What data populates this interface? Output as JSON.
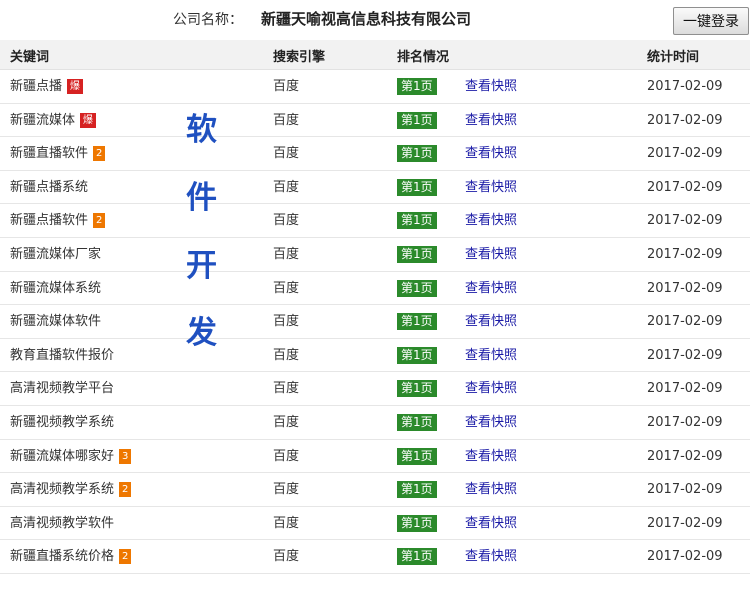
{
  "company": {
    "label": "公司名称：",
    "name": "新疆天喻视高信息科技有限公司"
  },
  "login_button": "一键登录",
  "headers": {
    "keyword": "关键词",
    "engine": "搜索引擎",
    "rank": "排名情况",
    "time": "统计时间"
  },
  "overlay_chars": [
    "软",
    "件",
    "开",
    "发"
  ],
  "rows": [
    {
      "keyword": "新疆点播",
      "badge": "爆",
      "badge_type": "hot",
      "engine": "百度",
      "rank": "第1页",
      "snapshot": "查看快照",
      "date": "2017-02-09"
    },
    {
      "keyword": "新疆流媒体",
      "badge": "爆",
      "badge_type": "hot",
      "engine": "百度",
      "rank": "第1页",
      "snapshot": "查看快照",
      "date": "2017-02-09"
    },
    {
      "keyword": "新疆直播软件",
      "badge": "2",
      "badge_type": "num",
      "engine": "百度",
      "rank": "第1页",
      "snapshot": "查看快照",
      "date": "2017-02-09"
    },
    {
      "keyword": "新疆点播系统",
      "badge": "",
      "badge_type": "",
      "engine": "百度",
      "rank": "第1页",
      "snapshot": "查看快照",
      "date": "2017-02-09"
    },
    {
      "keyword": "新疆点播软件",
      "badge": "2",
      "badge_type": "num",
      "engine": "百度",
      "rank": "第1页",
      "snapshot": "查看快照",
      "date": "2017-02-09"
    },
    {
      "keyword": "新疆流媒体厂家",
      "badge": "",
      "badge_type": "",
      "engine": "百度",
      "rank": "第1页",
      "snapshot": "查看快照",
      "date": "2017-02-09"
    },
    {
      "keyword": "新疆流媒体系统",
      "badge": "",
      "badge_type": "",
      "engine": "百度",
      "rank": "第1页",
      "snapshot": "查看快照",
      "date": "2017-02-09"
    },
    {
      "keyword": "新疆流媒体软件",
      "badge": "",
      "badge_type": "",
      "engine": "百度",
      "rank": "第1页",
      "snapshot": "查看快照",
      "date": "2017-02-09"
    },
    {
      "keyword": "教育直播软件报价",
      "badge": "",
      "badge_type": "",
      "engine": "百度",
      "rank": "第1页",
      "snapshot": "查看快照",
      "date": "2017-02-09"
    },
    {
      "keyword": "高清视频教学平台",
      "badge": "",
      "badge_type": "",
      "engine": "百度",
      "rank": "第1页",
      "snapshot": "查看快照",
      "date": "2017-02-09"
    },
    {
      "keyword": "新疆视频教学系统",
      "badge": "",
      "badge_type": "",
      "engine": "百度",
      "rank": "第1页",
      "snapshot": "查看快照",
      "date": "2017-02-09"
    },
    {
      "keyword": "新疆流媒体哪家好",
      "badge": "3",
      "badge_type": "num",
      "engine": "百度",
      "rank": "第1页",
      "snapshot": "查看快照",
      "date": "2017-02-09"
    },
    {
      "keyword": "高清视频教学系统",
      "badge": "2",
      "badge_type": "num",
      "engine": "百度",
      "rank": "第1页",
      "snapshot": "查看快照",
      "date": "2017-02-09"
    },
    {
      "keyword": "高清视频教学软件",
      "badge": "",
      "badge_type": "",
      "engine": "百度",
      "rank": "第1页",
      "snapshot": "查看快照",
      "date": "2017-02-09"
    },
    {
      "keyword": "新疆直播系统价格",
      "badge": "2",
      "badge_type": "num",
      "engine": "百度",
      "rank": "第1页",
      "snapshot": "查看快照",
      "date": "2017-02-09"
    }
  ],
  "colors": {
    "rank_badge": "#2b8a2b",
    "hot_badge": "#d62222",
    "num_badge": "#ee7700",
    "link": "#1a1aa6",
    "overlay": "#1f50c0"
  }
}
